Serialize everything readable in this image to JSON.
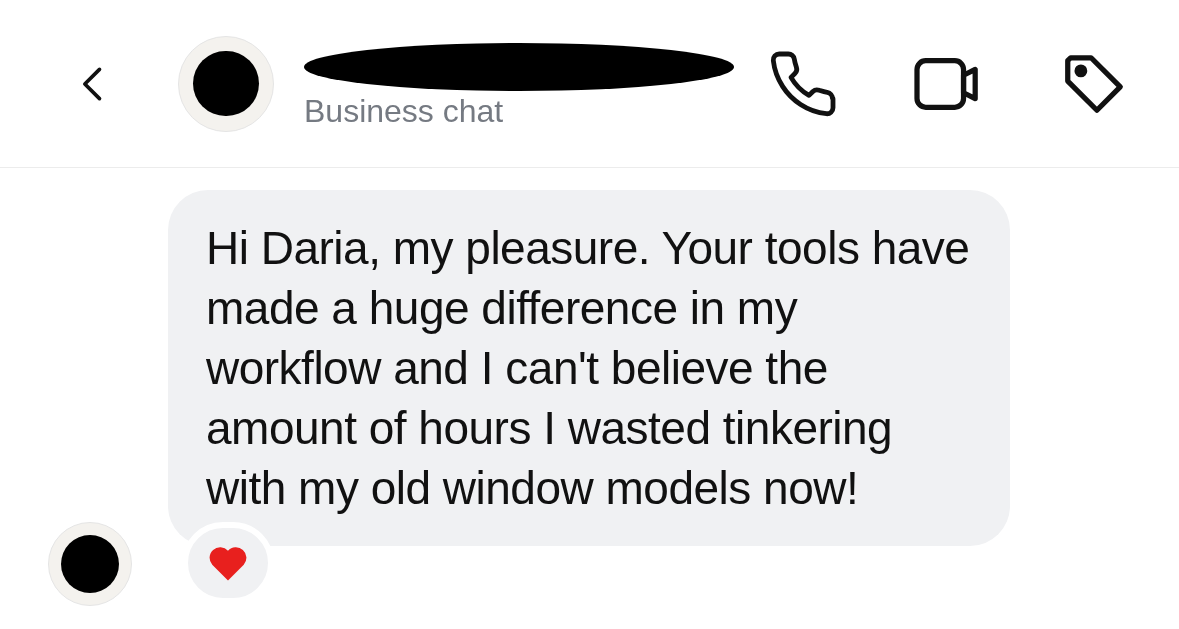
{
  "header": {
    "subtitle": "Business chat",
    "name_redacted": true
  },
  "message": {
    "text": "Hi Daria, my pleasure. Your tools have made a huge difference in my workflow and I can't believe the amount of hours I wasted tinkering with my old window models now!",
    "reaction": {
      "kind": "heart"
    }
  }
}
